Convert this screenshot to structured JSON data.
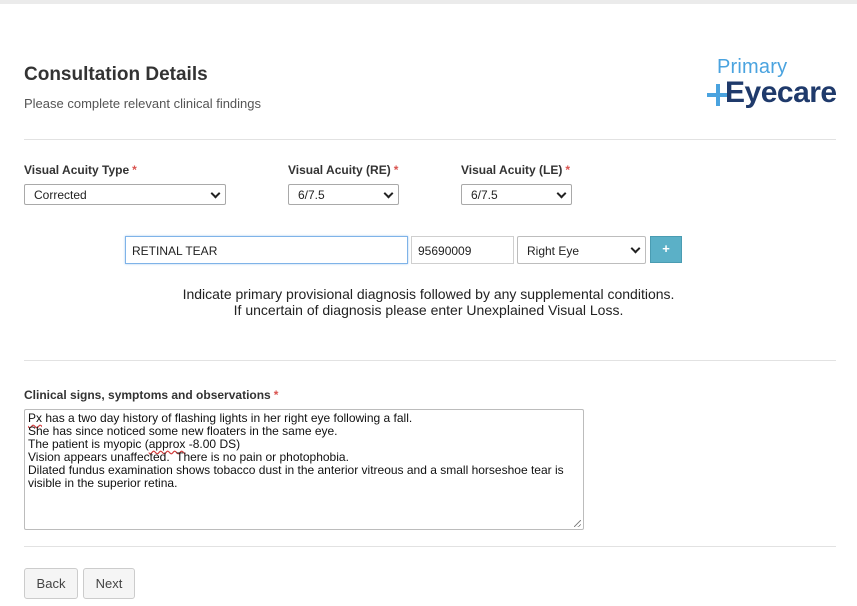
{
  "header": {
    "title": "Consultation Details",
    "subtitle": "Please complete relevant clinical findings",
    "logo_top": "Primary",
    "logo_bottom": "Eyecare"
  },
  "required_marker": "*",
  "visual_acuity": {
    "type_label": "Visual Acuity Type",
    "type_value": "Corrected",
    "re_label": "Visual Acuity (RE)",
    "re_value": "6/7.5",
    "le_label": "Visual Acuity (LE)",
    "le_value": "6/7.5"
  },
  "diagnosis": {
    "name_value": "RETINAL TEAR",
    "code_value": "95690009",
    "eye_value": "Right Eye",
    "add_label": "+",
    "help_line1": "Indicate primary provisional diagnosis followed by any supplemental conditions.",
    "help_line2": "If uncertain of diagnosis please enter Unexplained Visual Loss."
  },
  "clinical": {
    "label": "Clinical signs, symptoms and observations",
    "line1_word": "Px",
    "line1_rest": " has a two day history of flashing lights in her right eye following a fall.",
    "line2": "She has since noticed some new floaters in the same eye.",
    "line3_pre": "The patient is myopic (",
    "line3_word": "approx",
    "line3_post": " -8.00 DS)",
    "line4": "Vision appears unaffected.  There is no pain or photophobia.",
    "line5": "Dilated fundus examination shows tobacco dust in the anterior vitreous and a small horseshoe tear is",
    "line6": "visible in the superior retina."
  },
  "nav": {
    "back_label": "Back",
    "next_label": "Next"
  }
}
